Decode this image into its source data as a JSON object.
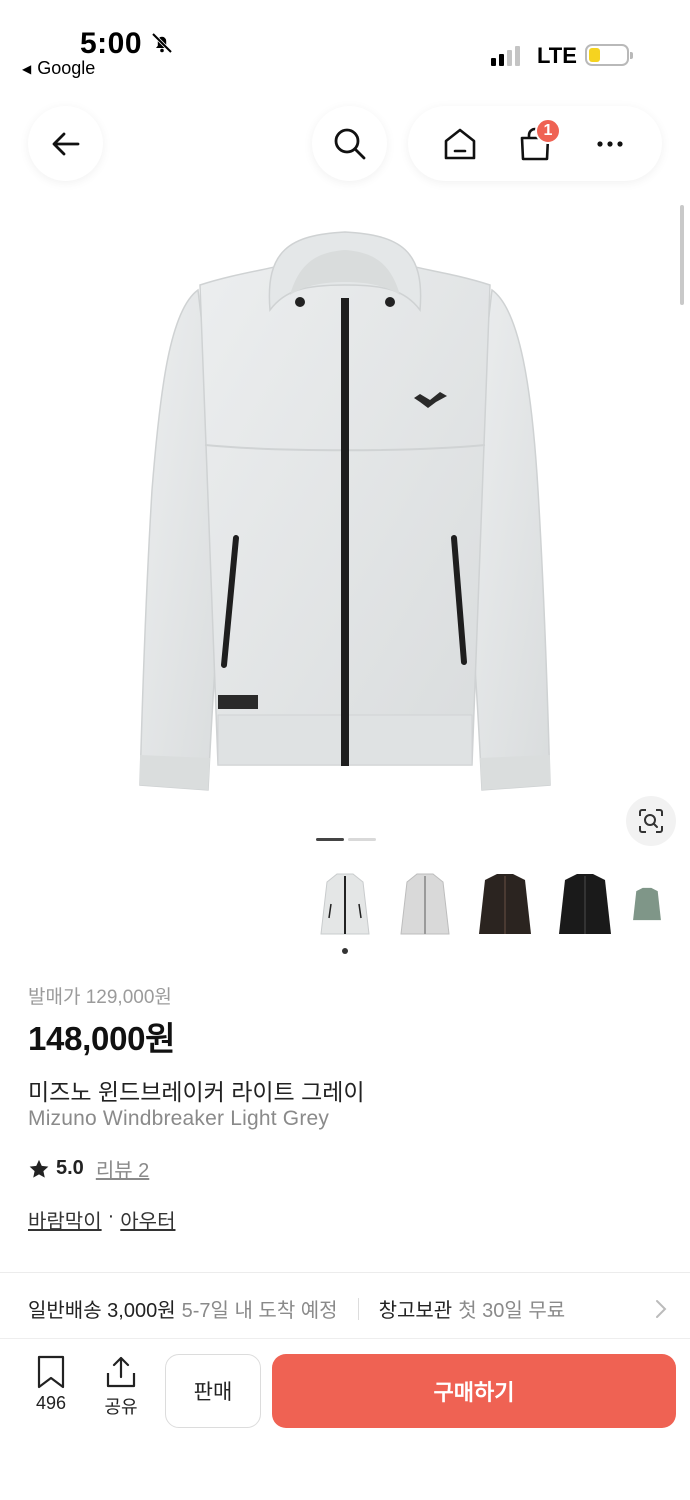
{
  "status_bar": {
    "time": "5:00",
    "back_app": "Google",
    "network": "LTE",
    "battery_level": 0.25,
    "icons": [
      "bell-slash-icon",
      "signal-icon",
      "battery-icon"
    ]
  },
  "nav": {
    "icons": [
      "back-arrow-icon",
      "search-icon",
      "home-icon",
      "shopping-bag-icon",
      "more-icon"
    ],
    "cart_badge": "1"
  },
  "gallery": {
    "total_pages": 2,
    "current_page": 1,
    "thumbnail_colors": [
      "#e4e6e6",
      "#d9d9d9",
      "#2b2420",
      "#1a1a1a",
      "#7f9688"
    ],
    "selected_thumbnail": 0,
    "icons": [
      "lens-search-icon"
    ]
  },
  "product": {
    "release_price": "발매가 129,000원",
    "price": "148,000원",
    "name_ko": "미즈노 윈드브레이커 라이트 그레이",
    "name_en": "Mizuno Windbreaker Light Grey",
    "rating": "5.0",
    "review_label": "리뷰 2",
    "category_1": "바람막이",
    "category_sep": "·",
    "category_2": "아우터"
  },
  "delivery": {
    "standard_label": "일반배송 3,000원",
    "standard_eta": "5-7일 내 도착 예정",
    "storage_label": "창고보관",
    "storage_note": "첫 30일 무료"
  },
  "bottom_bar": {
    "bookmark_count": "496",
    "share_label": "공유",
    "sell_label": "판매",
    "buy_label": "구매하기"
  },
  "colors": {
    "accent": "#ef6253",
    "jacket": "#e2e5e6"
  }
}
